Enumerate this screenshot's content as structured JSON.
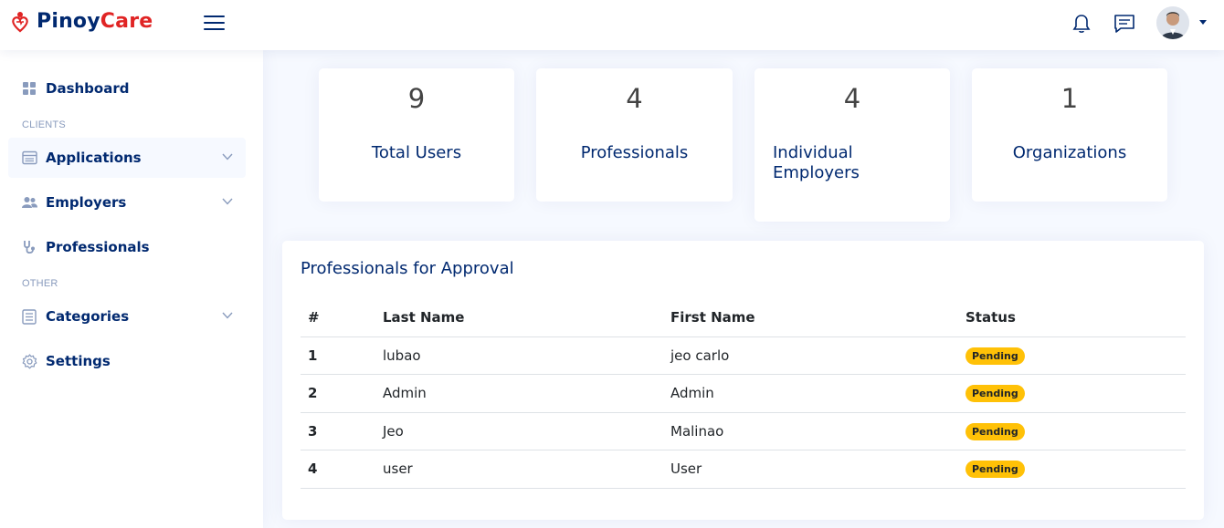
{
  "header": {
    "brand_part1": "Pinoy",
    "brand_part2": "Care",
    "icons": [
      "heart-logo-icon",
      "hamburger-menu-icon",
      "bell-icon",
      "chat-icon",
      "avatar",
      "caret-down-icon"
    ],
    "colors": {
      "brand": "#012970",
      "accent": "#e02424"
    }
  },
  "sidebar": {
    "items": [
      {
        "label": "Dashboard",
        "icon": "grid-icon"
      },
      {
        "heading": "CLIENTS"
      },
      {
        "label": "Applications",
        "icon": "layout-icon",
        "expandable": true
      },
      {
        "label": "Employers",
        "icon": "people-icon",
        "expandable": true
      },
      {
        "label": "Professionals",
        "icon": "stethoscope-icon"
      },
      {
        "heading": "OTHER"
      },
      {
        "label": "Categories",
        "icon": "list-icon",
        "expandable": true
      },
      {
        "label": "Settings",
        "icon": "gear-icon"
      }
    ]
  },
  "stats": [
    {
      "value": "9",
      "label": "Total Users"
    },
    {
      "value": "4",
      "label": "Professionals"
    },
    {
      "value": "4",
      "label": "Individual Employers"
    },
    {
      "value": "1",
      "label": "Organizations"
    }
  ],
  "approval": {
    "title": "Professionals for Approval",
    "columns": [
      "#",
      "Last Name",
      "First Name",
      "Status"
    ],
    "rows": [
      {
        "num": "1",
        "last": "lubao",
        "first": "jeo carlo",
        "status": "Pending"
      },
      {
        "num": "2",
        "last": "Admin",
        "first": "Admin",
        "status": "Pending"
      },
      {
        "num": "3",
        "last": "Jeo",
        "first": "Malinao",
        "status": "Pending"
      },
      {
        "num": "4",
        "last": "user",
        "first": "User",
        "status": "Pending"
      }
    ],
    "status_color": "#ffc107"
  }
}
